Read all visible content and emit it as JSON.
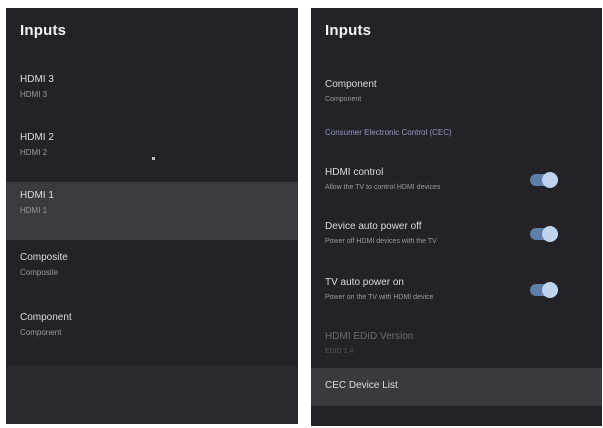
{
  "left_panel": {
    "title": "Inputs",
    "items": [
      {
        "label": "HDMI 3",
        "sub": "HDMI 3",
        "selected": false
      },
      {
        "label": "HDMI 2",
        "sub": "HDMI 2",
        "selected": false
      },
      {
        "label": "HDMI 1",
        "sub": "HDMI 1",
        "selected": true
      },
      {
        "label": "Composite",
        "sub": "Composite",
        "selected": false
      },
      {
        "label": "Component",
        "sub": "Component",
        "selected": false
      }
    ]
  },
  "right_panel": {
    "title": "Inputs",
    "component": {
      "label": "Component",
      "sub": "Component"
    },
    "section_link": "Consumer Electronic Control (CEC)",
    "settings": [
      {
        "label": "HDMI control",
        "sub": "Allow the TV to control HDMI devices",
        "enabled": true
      },
      {
        "label": "Device auto power off",
        "sub": "Power off HDMI devices with the TV",
        "enabled": true
      },
      {
        "label": "TV auto power on",
        "sub": "Power on the TV with HDMI device",
        "enabled": true
      }
    ],
    "edid": {
      "label": "HDMI EDID Version",
      "sub": "EDID 1.4"
    },
    "cec_device_list": "CEC Device List"
  }
}
